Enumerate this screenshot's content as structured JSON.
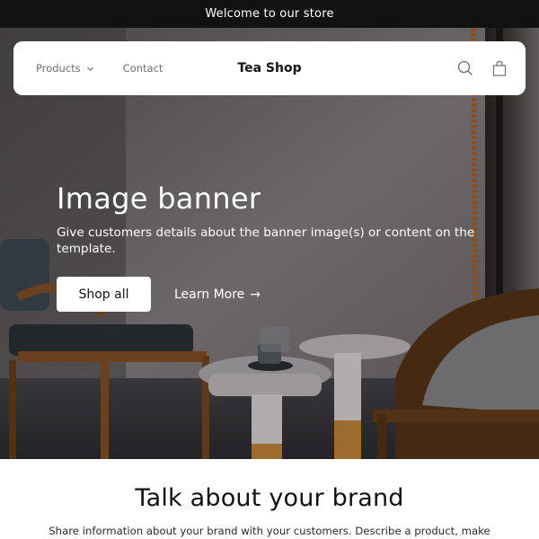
{
  "announcement": {
    "text": "Welcome to our store"
  },
  "header": {
    "nav": [
      {
        "label": "Products",
        "has_dropdown": true
      },
      {
        "label": "Contact",
        "has_dropdown": false
      }
    ],
    "logo": "Tea Shop",
    "icons": [
      "search-icon",
      "cart-icon"
    ]
  },
  "hero": {
    "title": "Image banner",
    "text": "Give customers details about the banner image(s) or content on the template.",
    "primary_button": "Shop all",
    "secondary_link": "Learn More",
    "secondary_link_arrow": "→"
  },
  "brand": {
    "title": "Talk about your brand",
    "text": "Share information about your brand with your customers. Describe a product, make"
  },
  "colors": {
    "announcement_bg": "#121212",
    "text_primary": "#121212",
    "nav_text": "#6f6f6f",
    "white": "#ffffff"
  }
}
